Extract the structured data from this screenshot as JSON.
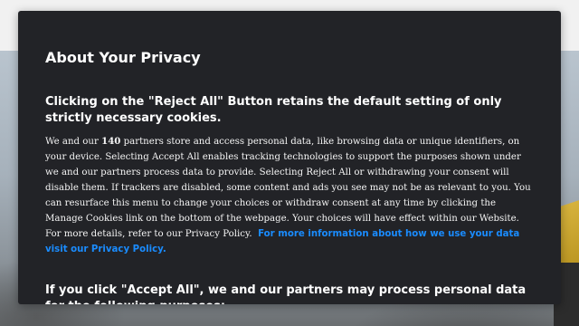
{
  "modal": {
    "title": "About Your Privacy",
    "reject_heading": "Clicking on the \"Reject All\" Button retains the default setting of only strictly necessary cookies.",
    "body_before_count": "We and our ",
    "partner_count": "140",
    "body_after_count": " partners store and access personal data, like browsing data or unique identifiers, on your device. Selecting Accept All enables tracking technologies to support the purposes shown under we and our partners process data to provide. Selecting Reject All or withdrawing your consent will disable them. If trackers are disabled, some content and ads you see may not be as relevant to you. You can resurface this menu to change your choices or withdraw consent at any time by clicking the Manage Cookies link on the bottom of the webpage. Your choices will have effect within our Website. For more details, refer to our Privacy Policy.",
    "privacy_link": "For more information about how we use your data visit our Privacy Policy.",
    "accept_heading": "If you click \"Accept All\", we and our partners may process personal data for the following purposes:"
  },
  "colors": {
    "modal_bg": "#222327",
    "link": "#1a8cff",
    "text": "#ffffff"
  }
}
